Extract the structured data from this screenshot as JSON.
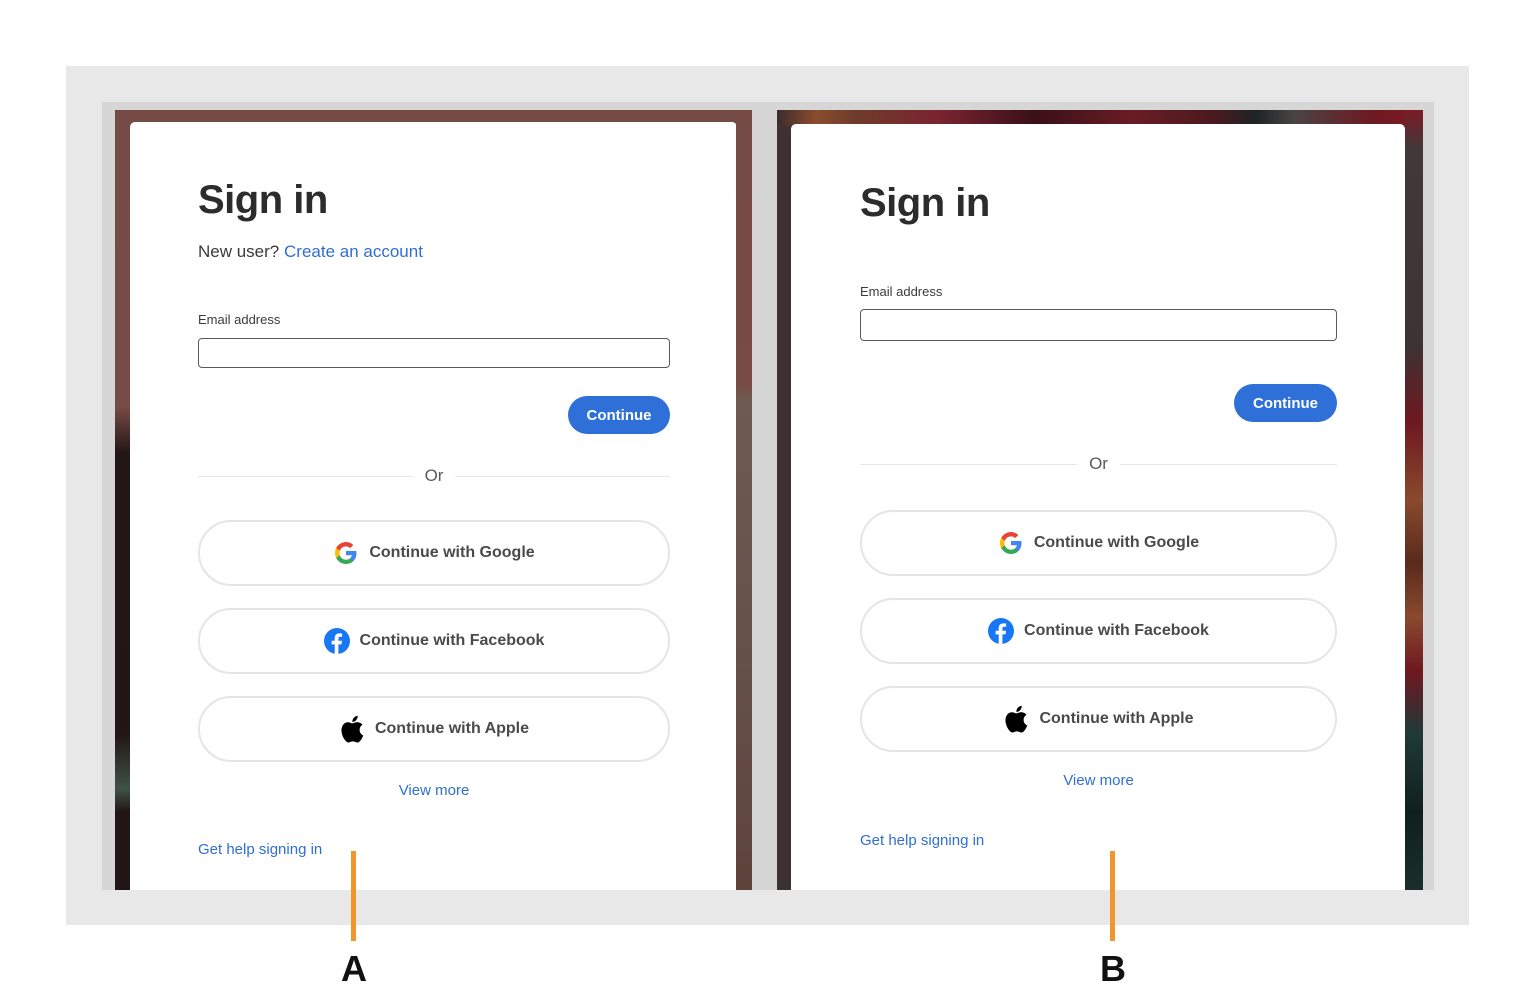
{
  "variants": {
    "a": {
      "marker_label": "A",
      "title": "Sign in",
      "new_user_prefix": "New user?",
      "create_account_link": "Create an account",
      "email_label": "Email address",
      "email_value": "",
      "continue_label": "Continue",
      "divider_text": "Or",
      "social_buttons": [
        {
          "label": "Continue with Google",
          "icon": "google-icon"
        },
        {
          "label": "Continue with Facebook",
          "icon": "facebook-icon"
        },
        {
          "label": "Continue with Apple",
          "icon": "apple-icon"
        }
      ],
      "view_more": "View more",
      "help_link": "Get help signing in"
    },
    "b": {
      "marker_label": "B",
      "title": "Sign in",
      "email_label": "Email address",
      "email_value": "",
      "continue_label": "Continue",
      "divider_text": "Or",
      "social_buttons": [
        {
          "label": "Continue with Google",
          "icon": "google-icon"
        },
        {
          "label": "Continue with Facebook",
          "icon": "facebook-icon"
        },
        {
          "label": "Continue with Apple",
          "icon": "apple-icon"
        }
      ],
      "view_more": "View more",
      "help_link": "Get help signing in"
    }
  },
  "colors": {
    "primary_blue": "#2f6fd8",
    "link_blue": "#2f6fd1",
    "marker_orange": "#f0962a",
    "facebook_blue": "#1877f2"
  }
}
